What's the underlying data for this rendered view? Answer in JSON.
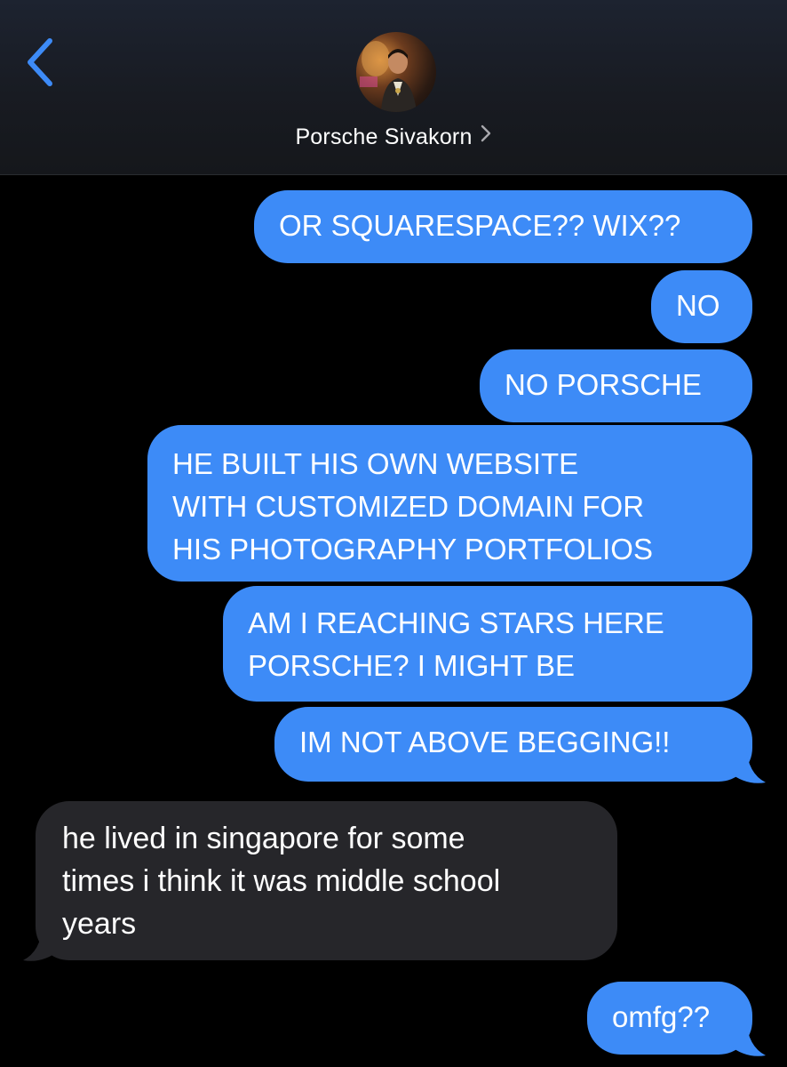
{
  "header": {
    "contact_name": "Porsche Sivakorn",
    "back_icon": "chevron-left-icon",
    "chevron_icon": "chevron-right-icon"
  },
  "colors": {
    "outgoing_bubble": "#3d8bf7",
    "incoming_bubble": "#26262a",
    "accent": "#3d8bf7",
    "background": "#000000"
  },
  "messages": [
    {
      "direction": "outgoing",
      "text": "OR SQUARESPACE?? WIX??"
    },
    {
      "direction": "outgoing",
      "text": "NO"
    },
    {
      "direction": "outgoing",
      "text": "NO PORSCHE"
    },
    {
      "direction": "outgoing",
      "text": "HE BUILT HIS OWN WEBSITE\nWITH CUSTOMIZED DOMAIN FOR\nHIS PHOTOGRAPHY PORTFOLIOS"
    },
    {
      "direction": "outgoing",
      "text": "AM I REACHING STARS HERE\nPORSCHE? I MIGHT BE"
    },
    {
      "direction": "outgoing",
      "text": "IM NOT ABOVE BEGGING!!"
    },
    {
      "direction": "incoming",
      "text": "he lived in singapore for some\ntimes i think it was middle school\nyears"
    },
    {
      "direction": "outgoing",
      "text": "omfg??"
    }
  ]
}
